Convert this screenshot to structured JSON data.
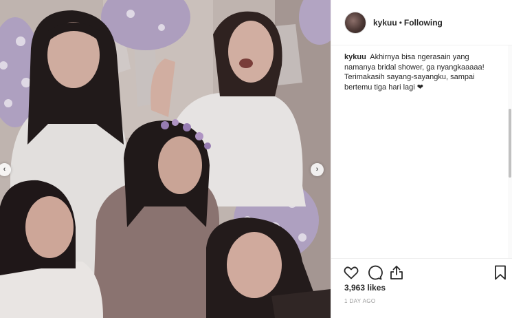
{
  "post": {
    "username": "kykuu",
    "follow_status": "Following",
    "separator": "•",
    "caption": "Akhirnya bisa ngerasain yang namanya bridal shower, ga nyangkaaaaa! Terimakasih sayang-sayangku, sampai bertemu tiga hari lagi ❤",
    "likes": "3,963 likes",
    "timestamp": "1 DAY AGO"
  },
  "carousel": {
    "prev_glyph": "‹",
    "next_glyph": "›"
  },
  "icons": {
    "like": "heart-icon",
    "comment": "comment-icon",
    "share": "share-icon",
    "save": "bookmark-icon"
  },
  "colors": {
    "balloon": "#b4a6c8",
    "balloon_dot": "#e9e4f0",
    "text": "#262626",
    "muted": "#999999",
    "border": "#efefef"
  }
}
